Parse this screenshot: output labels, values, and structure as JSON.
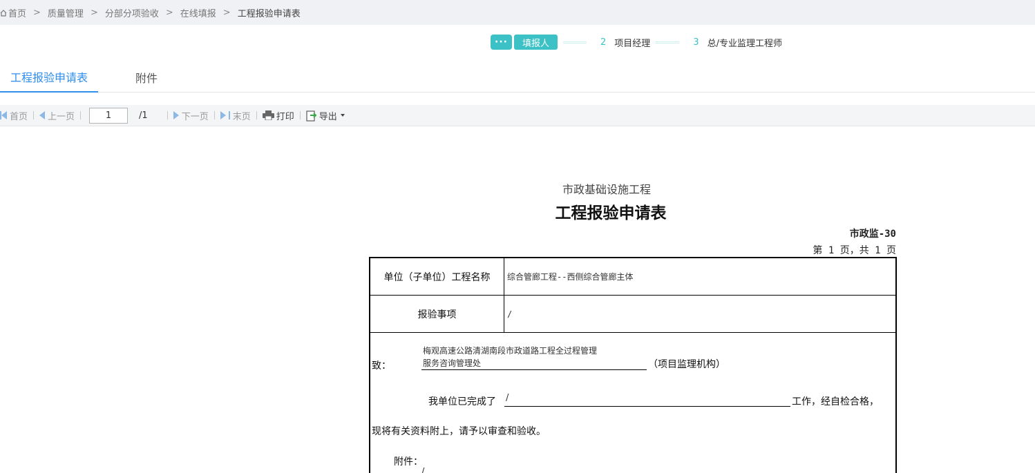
{
  "breadcrumb": {
    "items": [
      "首页",
      "质量管理",
      "分部分项验收",
      "在线填报",
      "工程报验申请表"
    ],
    "separator": ">"
  },
  "steps": {
    "dots": "···",
    "current_label": "填报人",
    "items": [
      {
        "num": "2",
        "label": "项目经理"
      },
      {
        "num": "3",
        "label": "总/专业监理工程师"
      }
    ]
  },
  "tabs": {
    "active": "工程报验申请表",
    "other": "附件"
  },
  "toolbar": {
    "first": "首页",
    "prev": "上一页",
    "page_value": "1",
    "page_total": "/1",
    "next": "下一页",
    "last": "末页",
    "print": "打印",
    "export": "导出"
  },
  "report": {
    "subtitle": "市政基础设施工程",
    "title": "工程报验申请表",
    "form_code": "市政监-30",
    "page_info": "第 1 页，共 1 页",
    "unit_name_label": "单位（子单位）工程名称",
    "unit_name_value": "综合管廊工程--西侧综合管廊主体",
    "item_label": "报验事项",
    "item_value": "/",
    "to_label": "致：",
    "to_org_line1": "梅观高速公路清湖南段市政道路工程全过程管理",
    "to_org_line2": "服务咨询管理处",
    "to_suffix": "（项目监理机构）",
    "done_label": "我单位已完成了",
    "done_value": "/",
    "done_suffix": "工作，经自检合格，",
    "line2": "现将有关资料附上，请予以审查和验收。",
    "attach_label": "附件：",
    "attach_value": "/"
  },
  "colors": {
    "accent": "#3cc1c6",
    "tab_active": "#2e8ded"
  }
}
